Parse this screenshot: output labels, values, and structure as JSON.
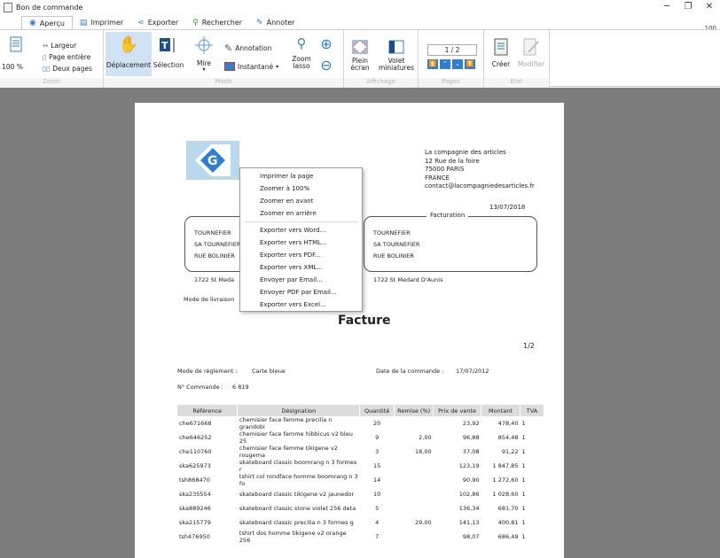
{
  "window": {
    "title": "Bon de commande",
    "zoom": "100"
  },
  "tabs": [
    {
      "label": "Aperçu",
      "icon": "preview-icon"
    },
    {
      "label": "Imprimer",
      "icon": "printer-icon"
    },
    {
      "label": "Exporter",
      "icon": "export-icon"
    },
    {
      "label": "Rechercher",
      "icon": "search-icon"
    },
    {
      "label": "Annoter",
      "icon": "pen-icon"
    }
  ],
  "ribbon": {
    "zoom": {
      "group": "Zoom",
      "percent": "100 %",
      "largeur": "Largeur",
      "page_entiere": "Page entière",
      "deux_pages": "Deux pages"
    },
    "mode": {
      "group": "Mode",
      "deplacement": "Déplacement",
      "selection": "Sélection",
      "mire": "Mire",
      "annotation": "Annotation",
      "instantane": "Instantané",
      "zoom_lasso": "Zoom lasso"
    },
    "affichage": {
      "group": "Affichage",
      "plein_ecran": "Plein écran",
      "volet": "Volet miniatures"
    },
    "pages": {
      "group": "Pages",
      "counter": "1 / 2"
    },
    "etat": {
      "group": "Etat",
      "creer": "Créer",
      "modifier": "Modifier"
    }
  },
  "document": {
    "company": {
      "name": "La compagnie des articles",
      "street": "12 Rue de la foire",
      "city": "75000 PARIS",
      "country": "FRANCE",
      "email": "contact@lacompagniedesarticles.fr"
    },
    "date": "13/07/2018",
    "delivery": {
      "line1": "TOURNEFIER",
      "line2": "SA TOURNEFIER",
      "line3": "RUE BOLINIER",
      "line4": "1722     St Meda"
    },
    "billing": {
      "label": "Facturation",
      "line1": "TOURNEFIER",
      "line2": "SA TOURNEFIER",
      "line3": "RUE BOLINIER",
      "line4": "1722     St Medard D'Aunis"
    },
    "mode_livraison": "Mode de livraison",
    "heading": "Facture",
    "page": "1/2",
    "reglement_label": "Mode de règlement :",
    "reglement_value": "Carte bleue",
    "date_cmd_label": "Date de la commande :",
    "date_cmd_value": "17/07/2012",
    "num_cmd_label": "N° Commande :",
    "num_cmd_value": "6 819",
    "columns": [
      "Référence",
      "Désignation",
      "Quantité",
      "Remise (%)",
      "Prix de vente",
      "Montant",
      "TVA"
    ],
    "rows": [
      [
        "che671668",
        "chemisier face femme precilia n grandobi",
        "20",
        "",
        "23,92",
        "478,40",
        "1"
      ],
      [
        "che646252",
        "chemisier face femme hibbicus v2 bleu 25",
        "9",
        "2,00",
        "96,88",
        "854,48",
        "1"
      ],
      [
        "che110760",
        "chemisier face femme tikigene v2 rougema",
        "3",
        "18,00",
        "37,08",
        "91,22",
        "1"
      ],
      [
        "ska625973",
        "skateboard classic boomrang n 3 formes r",
        "15",
        "",
        "123,19",
        "1 847,85",
        "1"
      ],
      [
        "tsh868470",
        "tshirt col rondface homme boomrang n 3 fo",
        "14",
        "",
        "90,90",
        "1 272,60",
        "1"
      ],
      [
        "ska235554",
        "skateboard classic tikigene v2 jaunedor",
        "10",
        "",
        "102,86",
        "1 028,60",
        "1"
      ],
      [
        "ska889246",
        "skateboard classic stone violet 256 deta",
        "5",
        "",
        "136,34",
        "681,70",
        "1"
      ],
      [
        "ska215779",
        "skateboard classic precilia n 3 formes g",
        "4",
        "29,00",
        "141,13",
        "400,81",
        "1"
      ],
      [
        "tsh476950",
        "tshirt dos homme tikigene v2 orange 256",
        "7",
        "",
        "98,07",
        "686,49",
        "1"
      ]
    ]
  },
  "context_menu": {
    "items": [
      "Imprimer la page",
      "Zoomer à 100%",
      "Zoomer en avant",
      "Zoomer en arrière",
      "Exporter vers Word...",
      "Exporter vers HTML...",
      "Exporter vers PDF...",
      "Exporter vers XML...",
      "Envoyer par Email...",
      "Envoyer PDF par Email...",
      "Exporter vers Excel..."
    ]
  },
  "colors": {
    "accent": "#2f7fd1",
    "selected_bg": "#cfe3f5",
    "workspace_bg": "#7d7d7d",
    "logo_bg": "#b9d8ec"
  }
}
